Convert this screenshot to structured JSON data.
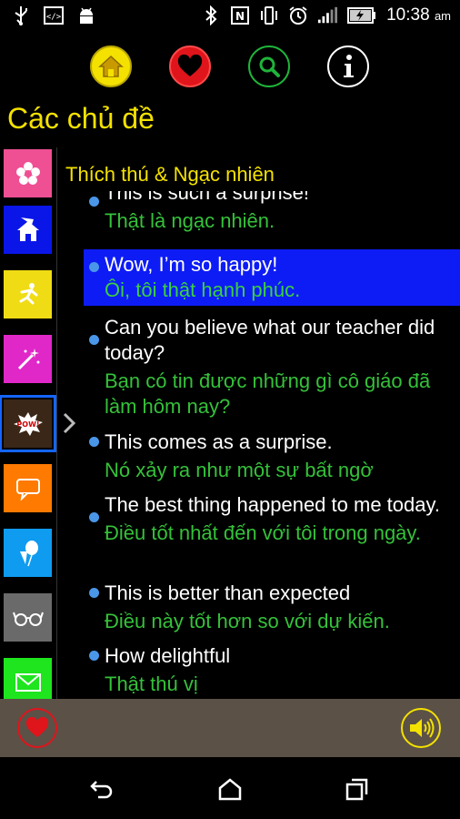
{
  "status_bar": {
    "time": "10:38",
    "time_suffix": "am",
    "left_icons": [
      "usb-icon",
      "code-icon",
      "android-icon"
    ],
    "right_icons": [
      "bluetooth-icon",
      "nfc-icon",
      "vibrate-icon",
      "alarm-icon",
      "signal-icon",
      "battery-charging-icon"
    ]
  },
  "top_nav": {
    "items": [
      {
        "name": "home",
        "icon": "home-icon",
        "color": "#f4e100"
      },
      {
        "name": "favorites",
        "icon": "heart-icon",
        "color": "#e0141b"
      },
      {
        "name": "search",
        "icon": "search-icon",
        "color": "#1fb43a"
      },
      {
        "name": "info",
        "icon": "info-icon",
        "color": "#ffffff"
      }
    ]
  },
  "page": {
    "title": "Các chủ đề",
    "section_title": "Thích thú & Ngạc nhiên"
  },
  "categories": [
    {
      "icon": "flower-icon",
      "color": "#ef4f93"
    },
    {
      "icon": "house-icon",
      "color": "#0a16e8"
    },
    {
      "icon": "running-figure-icon",
      "color": "#f0dc14"
    },
    {
      "icon": "magic-wand-icon",
      "color": "#e028c8"
    },
    {
      "icon": "pow-icon",
      "color": "#3a2717",
      "selected": true
    },
    {
      "icon": "speech-bubble-icon",
      "color": "#ff7a00"
    },
    {
      "icon": "balloons-icon",
      "color": "#0f9bf0"
    },
    {
      "icon": "glasses-icon",
      "color": "#ffffff"
    },
    {
      "icon": "envelope-icon",
      "color": "#1ee51e"
    }
  ],
  "phrases": [
    {
      "en": "This is such a surprise!",
      "vi": "Thật là ngạc nhiên."
    },
    {
      "en": "Wow, I’m so happy!",
      "vi": "Ôi, tôi thật hạnh phúc.",
      "active": true
    },
    {
      "en": "Can you believe what our teacher did today?",
      "vi": "Bạn có tin được những gì cô giáo đã làm hôm nay?"
    },
    {
      "en": "This comes as a surprise.",
      "vi": "Nó xảy ra như một sự bất ngờ"
    },
    {
      "en": "The best thing happened to me today.",
      "vi": "Điều tốt nhất đến với tôi trong ngày."
    },
    {
      "en": "This is better than expected",
      "vi": "Điều này tốt hơn so với dự kiến."
    },
    {
      "en": "How delightful",
      "vi": "Thật thú vị"
    }
  ],
  "action_bar": {
    "left_icon": "heart-icon",
    "right_icon": "speaker-icon"
  },
  "system_nav": [
    "back-icon",
    "home-outline-icon",
    "recents-icon"
  ]
}
